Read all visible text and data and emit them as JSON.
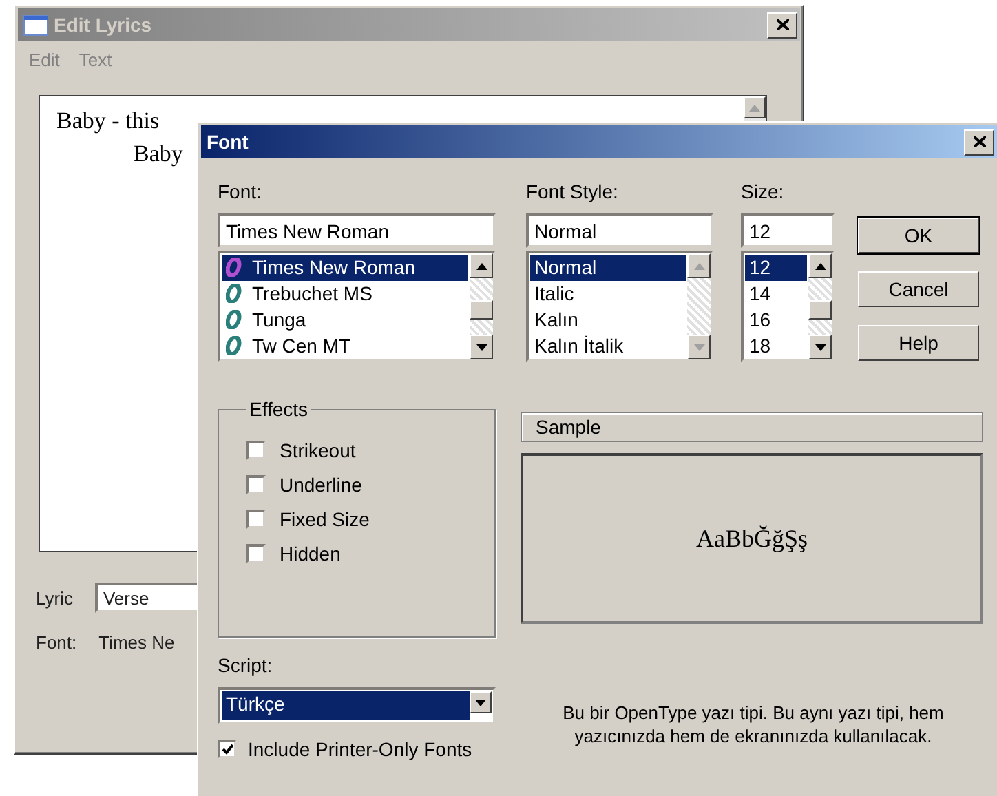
{
  "back_window": {
    "title": "Edit Lyrics",
    "menu": [
      "Edit",
      "Text"
    ],
    "lyrics_lines": [
      "Baby - this",
      "Baby"
    ],
    "lyric_label": "Lyric",
    "lyric_value": "Verse",
    "font_label": "Font:",
    "font_value": "Times Ne"
  },
  "dialog": {
    "title": "Font",
    "font": {
      "label": "Font:",
      "value": "Times New Roman",
      "scrollable": true,
      "items": [
        {
          "label": "Times New Roman",
          "selected": true
        },
        {
          "label": "Trebuchet MS",
          "selected": false
        },
        {
          "label": "Tunga",
          "selected": false
        },
        {
          "label": "Tw Cen MT",
          "selected": false
        }
      ]
    },
    "style": {
      "label": "Font Style:",
      "value": "Normal",
      "scrollable": false,
      "items": [
        {
          "label": "Normal",
          "selected": true
        },
        {
          "label": "Italic",
          "selected": false
        },
        {
          "label": "Kalın",
          "selected": false
        },
        {
          "label": "Kalın İtalik",
          "selected": false
        }
      ]
    },
    "size": {
      "label": "Size:",
      "value": "12",
      "scrollable": true,
      "items": [
        {
          "label": "12",
          "selected": true
        },
        {
          "label": "14",
          "selected": false
        },
        {
          "label": "16",
          "selected": false
        },
        {
          "label": "18",
          "selected": false
        }
      ]
    },
    "buttons": [
      {
        "label": "OK",
        "default": true
      },
      {
        "label": "Cancel",
        "default": false
      },
      {
        "label": "Help",
        "default": false
      }
    ],
    "effects": {
      "title": "Effects",
      "options": [
        {
          "label": "Strikeout",
          "checked": false
        },
        {
          "label": "Underline",
          "checked": false
        },
        {
          "label": "Fixed Size",
          "checked": false
        },
        {
          "label": "Hidden",
          "checked": false
        }
      ]
    },
    "sample": {
      "title": "Sample",
      "text": "AaBbĞğŞş"
    },
    "script": {
      "label": "Script:",
      "value": "Türkçe"
    },
    "printer_only": {
      "label": "Include Printer-Only Fonts",
      "checked": true
    },
    "description": "Bu bir OpenType yazı tipi. Bu aynı yazı tipi, hem yazıcınızda hem de ekranınızda kullanılacak."
  }
}
